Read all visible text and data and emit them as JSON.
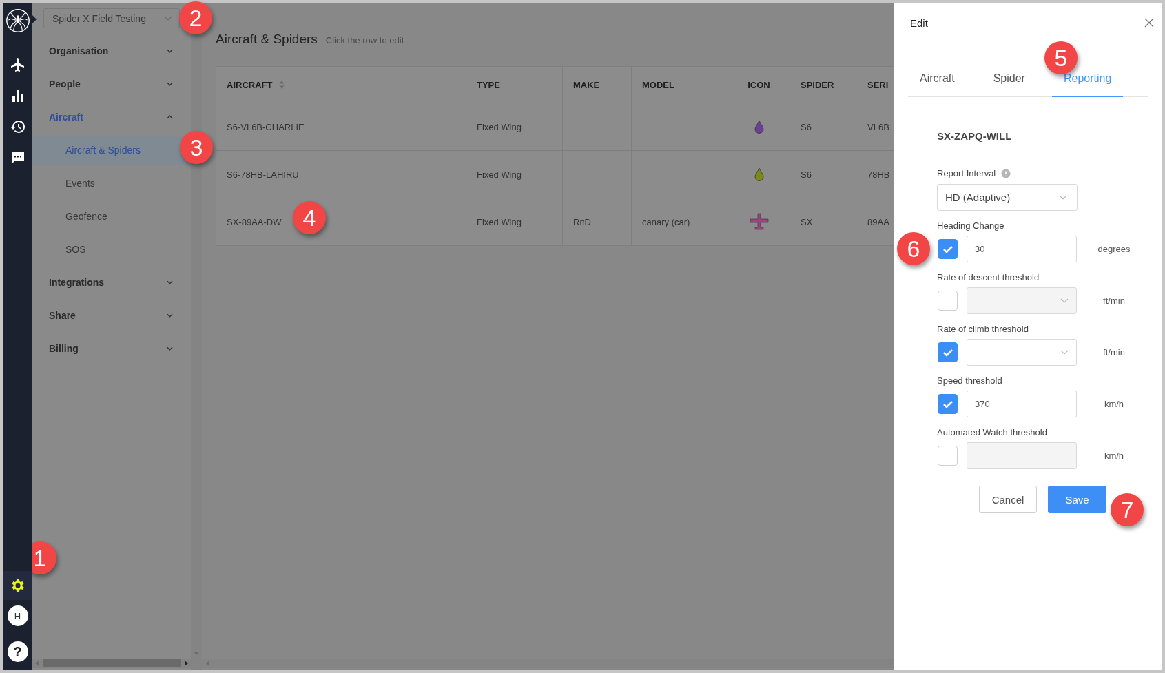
{
  "rail": {
    "items": [
      {
        "kind": "aircraft",
        "selected": false
      },
      {
        "kind": "chart",
        "selected": false
      },
      {
        "kind": "history",
        "selected": false
      },
      {
        "kind": "messages",
        "selected": false
      }
    ],
    "settings": {
      "selected": true
    },
    "avatar": "H",
    "help": "?"
  },
  "sidebar": {
    "workspace": "Spider X Field Testing",
    "items": [
      {
        "label": "Organisation",
        "expanded": false
      },
      {
        "label": "People",
        "expanded": false
      },
      {
        "label": "Aircraft",
        "expanded": true,
        "children": [
          {
            "label": "Aircraft & Spiders",
            "selected": true
          },
          {
            "label": "Events",
            "selected": false
          },
          {
            "label": "Geofence",
            "selected": false
          },
          {
            "label": "SOS",
            "selected": false
          }
        ]
      },
      {
        "label": "Integrations",
        "expanded": false
      },
      {
        "label": "Share",
        "expanded": false
      },
      {
        "label": "Billing",
        "expanded": false
      }
    ]
  },
  "page": {
    "title": "Aircraft & Spiders",
    "hint": "Click the row to edit"
  },
  "table": {
    "columns": [
      {
        "label": "AIRCRAFT",
        "sortable": true
      },
      {
        "label": "TYPE"
      },
      {
        "label": "MAKE"
      },
      {
        "label": "MODEL"
      },
      {
        "label": "ICON"
      },
      {
        "label": "SPIDER"
      },
      {
        "label": "SERI"
      }
    ],
    "rows": [
      {
        "aircraft": "S6-VL6B-CHARLIE",
        "type": "Fixed Wing",
        "icon": {
          "kind": "drop",
          "color": "#6a3f96"
        },
        "spider": "S6",
        "serial": "VL6B"
      },
      {
        "aircraft": "S6-78HB-LAHIRU",
        "type": "Fixed Wing",
        "icon": {
          "kind": "drop",
          "color": "#7a8a12"
        },
        "spider": "S6",
        "serial": "78HB"
      },
      {
        "aircraft": "SX-89AA-DW",
        "type": "Fixed Wing",
        "make": "RnD",
        "model": "canary (car)",
        "icon": {
          "kind": "plane",
          "color": "#a3407e"
        },
        "spider": "SX",
        "serial": "89AA"
      }
    ]
  },
  "drawer": {
    "title": "Edit",
    "tabs": [
      {
        "label": "Aircraft",
        "selected": false
      },
      {
        "label": "Spider",
        "selected": false
      },
      {
        "label": "Reporting",
        "selected": true
      }
    ],
    "aircraft_name": "SX-ZAPQ-WILL",
    "report_interval": {
      "label": "Report Interval",
      "value": "HD (Adaptive)"
    },
    "thresholds": [
      {
        "label": "Heading Change",
        "kind": "input",
        "checked": true,
        "value": "30",
        "unit": "degrees"
      },
      {
        "label": "Rate of descent threshold",
        "kind": "select",
        "checked": false,
        "unit": "ft/min"
      },
      {
        "label": "Rate of climb threshold",
        "kind": "select",
        "checked": true,
        "unit": "ft/min"
      },
      {
        "label": "Speed threshold",
        "kind": "input",
        "checked": true,
        "value": "370",
        "unit": "km/h"
      },
      {
        "label": "Automated Watch threshold",
        "kind": "input",
        "checked": false,
        "unit": "km/h"
      }
    ],
    "buttons": {
      "cancel": "Cancel",
      "save": "Save"
    }
  },
  "callouts": [
    {
      "number": "1"
    },
    {
      "number": "2"
    },
    {
      "number": "3"
    },
    {
      "number": "4"
    },
    {
      "number": "5"
    },
    {
      "number": "6"
    },
    {
      "number": "7"
    }
  ]
}
